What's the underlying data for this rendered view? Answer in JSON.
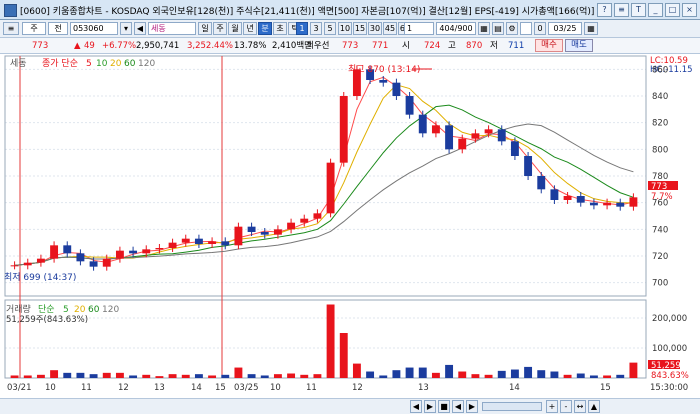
{
  "window": {
    "title": "[0600] 키움종합차트 - KOSDAQ 외국인보유[128(천)] 주식수[21,411(천)] 액면[500] 자본금[107(억)] 결산[12월] EPS[-419] 시가총액[166(억)]",
    "buttons": [
      "?",
      "≡",
      "T",
      "_",
      "□",
      "×"
    ]
  },
  "toolbar": {
    "type_select": "주",
    "type_select2": "전",
    "code": "053060",
    "name": "세동",
    "periods": [
      "일",
      "주",
      "월",
      "년",
      "분",
      "초",
      "틱"
    ],
    "active_period": "분",
    "minutes": [
      "1",
      "3",
      "5",
      "10",
      "15",
      "30",
      "45",
      "60"
    ],
    "active_minute": "1",
    "count_select": "1",
    "page_count": "404/900",
    "checkbox_label": "0",
    "date": "03/25"
  },
  "quote": {
    "price": "773",
    "change": "49",
    "change_pct": "+6.77%",
    "volume": "2,950,741",
    "volume_ratio": "3,252.44%",
    "turnover": "13.78%",
    "amount": "2,410백만",
    "ask_label": "최우선",
    "ask": "773",
    "bid": "771",
    "open_label": "시",
    "open": "724",
    "high_label": "고",
    "high": "870",
    "low_label": "저",
    "low": "711",
    "buy_button": "매수",
    "sell_button": "매도"
  },
  "price_panel": {
    "legend_name": "세동",
    "ma_label": "종가 단순",
    "ma_periods": [
      "5",
      "10",
      "20",
      "60",
      "120"
    ],
    "ma_colors": [
      "#ff4c4c",
      "#2a9d2a",
      "#e0b000",
      "#1b8a1b",
      "#777777"
    ],
    "lc": "LC:10.59",
    "hc": "HC:-11.15",
    "max_annotation": "최고 870 (13:14)",
    "min_annotation": "최저 699 (14:37)",
    "current_price_tag": "773",
    "current_pct_tag": "7.7%",
    "y_ticks": [
      "860",
      "840",
      "820",
      "800",
      "780",
      "760",
      "740",
      "720",
      "700"
    ]
  },
  "volume_panel": {
    "legend_name": "거래량",
    "ma_label": "단순",
    "ma_periods": [
      "5",
      "20",
      "60",
      "120"
    ],
    "current_volume": "51,259주(843.63%)",
    "volume_tag": "51,259",
    "volume_pct_tag": "843.63%",
    "y_ticks": [
      "200,000",
      "100,000"
    ]
  },
  "x_axis": {
    "labels": [
      "03/21",
      "10",
      "11",
      "12",
      "13",
      "14",
      "15",
      "03/25",
      "10",
      "11",
      "12",
      "13",
      "14",
      "15"
    ],
    "time_label": "15:30:00"
  },
  "chart_data": {
    "type": "line",
    "title": "",
    "series": [
      {
        "name": "세동",
        "values": [
          713,
          715,
          718,
          728,
          722,
          716,
          712,
          718,
          724,
          722,
          725,
          726,
          730,
          733,
          729,
          731,
          728,
          742,
          738,
          736,
          740,
          745,
          748,
          752,
          790,
          840,
          860,
          852,
          850,
          840,
          826,
          812,
          818,
          800,
          808,
          812,
          815,
          806,
          795,
          780,
          770,
          762,
          765,
          760,
          758,
          760,
          757,
          764
        ]
      }
    ],
    "ylim": [
      690,
      870
    ],
    "grid": true
  },
  "bottom": {
    "controls": [
      "◀",
      "▶",
      "■",
      "◀",
      "▶"
    ],
    "icons": [
      "+",
      "-",
      "↔",
      "▲"
    ]
  }
}
